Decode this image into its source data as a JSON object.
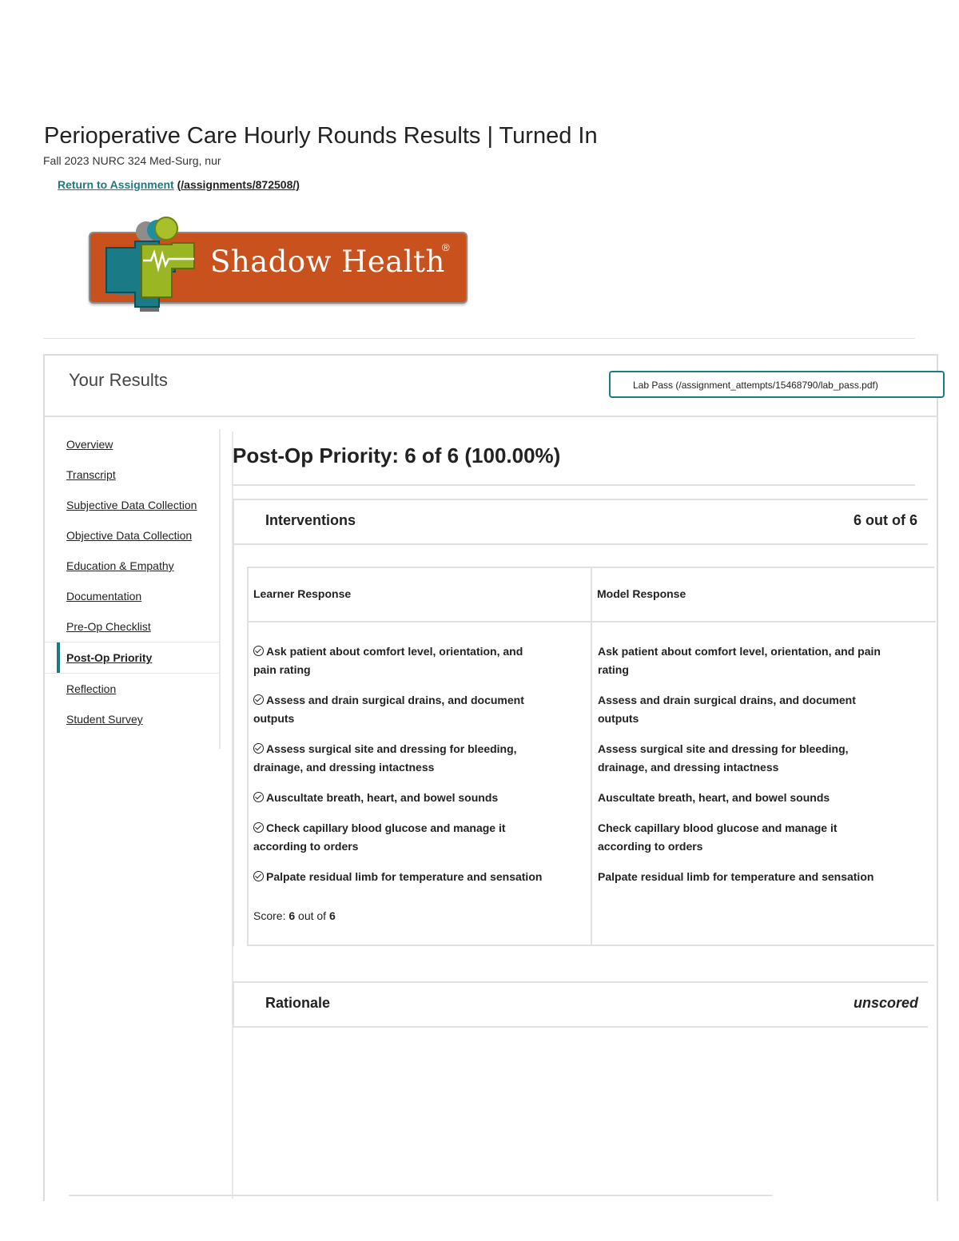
{
  "page": {
    "title": "Perioperative Care Hourly Rounds Results | Turned In",
    "course": "Fall 2023 NURC 324 Med-Surg, nur",
    "return_link_label": "Return to Assignment",
    "return_link_path": "(/assignments/872508/)"
  },
  "logo": {
    "text": "Shadow Health",
    "reg_mark": "®"
  },
  "results": {
    "title": "Your Results",
    "lab_pass_label": "Lab Pass (/assignment_attempts/15468790/lab_pass.pdf)"
  },
  "sidebar": {
    "items": [
      {
        "label": "Overview",
        "active": false
      },
      {
        "label": "Transcript",
        "active": false
      },
      {
        "label": "Subjective Data Collection",
        "active": false
      },
      {
        "label": "Objective Data Collection",
        "active": false
      },
      {
        "label": "Education & Empathy",
        "active": false
      },
      {
        "label": "Documentation",
        "active": false
      },
      {
        "label": "Pre-Op Checklist",
        "active": false
      },
      {
        "label": "Post-Op Priority",
        "active": true
      },
      {
        "label": "Reflection",
        "active": false
      },
      {
        "label": "Student Survey",
        "active": false
      }
    ]
  },
  "main": {
    "heading": "Post-Op Priority: 6 of 6 (100.00%)",
    "interventions": {
      "title": "Interventions",
      "score_label": "6 out of 6",
      "learner_header": "Learner Response",
      "model_header": "Model Response",
      "learner_items": [
        [
          "Ask patient about comfort level, orientation, and",
          "pain rating"
        ],
        [
          "Assess and drain surgical drains, and document",
          "outputs"
        ],
        [
          "Assess surgical site and dressing for bleeding,",
          "drainage, and dressing intactness"
        ],
        [
          "Auscultate breath, heart, and bowel sounds"
        ],
        [
          "Check capillary blood glucose and manage it",
          "according to orders"
        ],
        [
          "Palpate residual limb for temperature and sensation"
        ]
      ],
      "model_items": [
        [
          "Ask patient about comfort level, orientation, and pain",
          "rating"
        ],
        [
          "Assess and drain surgical drains, and document",
          "outputs"
        ],
        [
          "Assess surgical site and dressing for bleeding,",
          "drainage, and dressing intactness"
        ],
        [
          "Auscultate breath, heart, and bowel sounds"
        ],
        [
          "Check capillary blood glucose and manage it",
          "according to orders"
        ],
        [
          "Palpate residual limb for temperature and sensation"
        ]
      ],
      "score_prefix": "Score:",
      "score_value": "6",
      "score_mid": "out of",
      "score_total": "6"
    },
    "rationale": {
      "title": "Rationale",
      "score_label": "unscored"
    }
  },
  "colors": {
    "accent": "#1a7a86",
    "logo_orange": "#c8511e",
    "logo_green": "#9bb623"
  }
}
